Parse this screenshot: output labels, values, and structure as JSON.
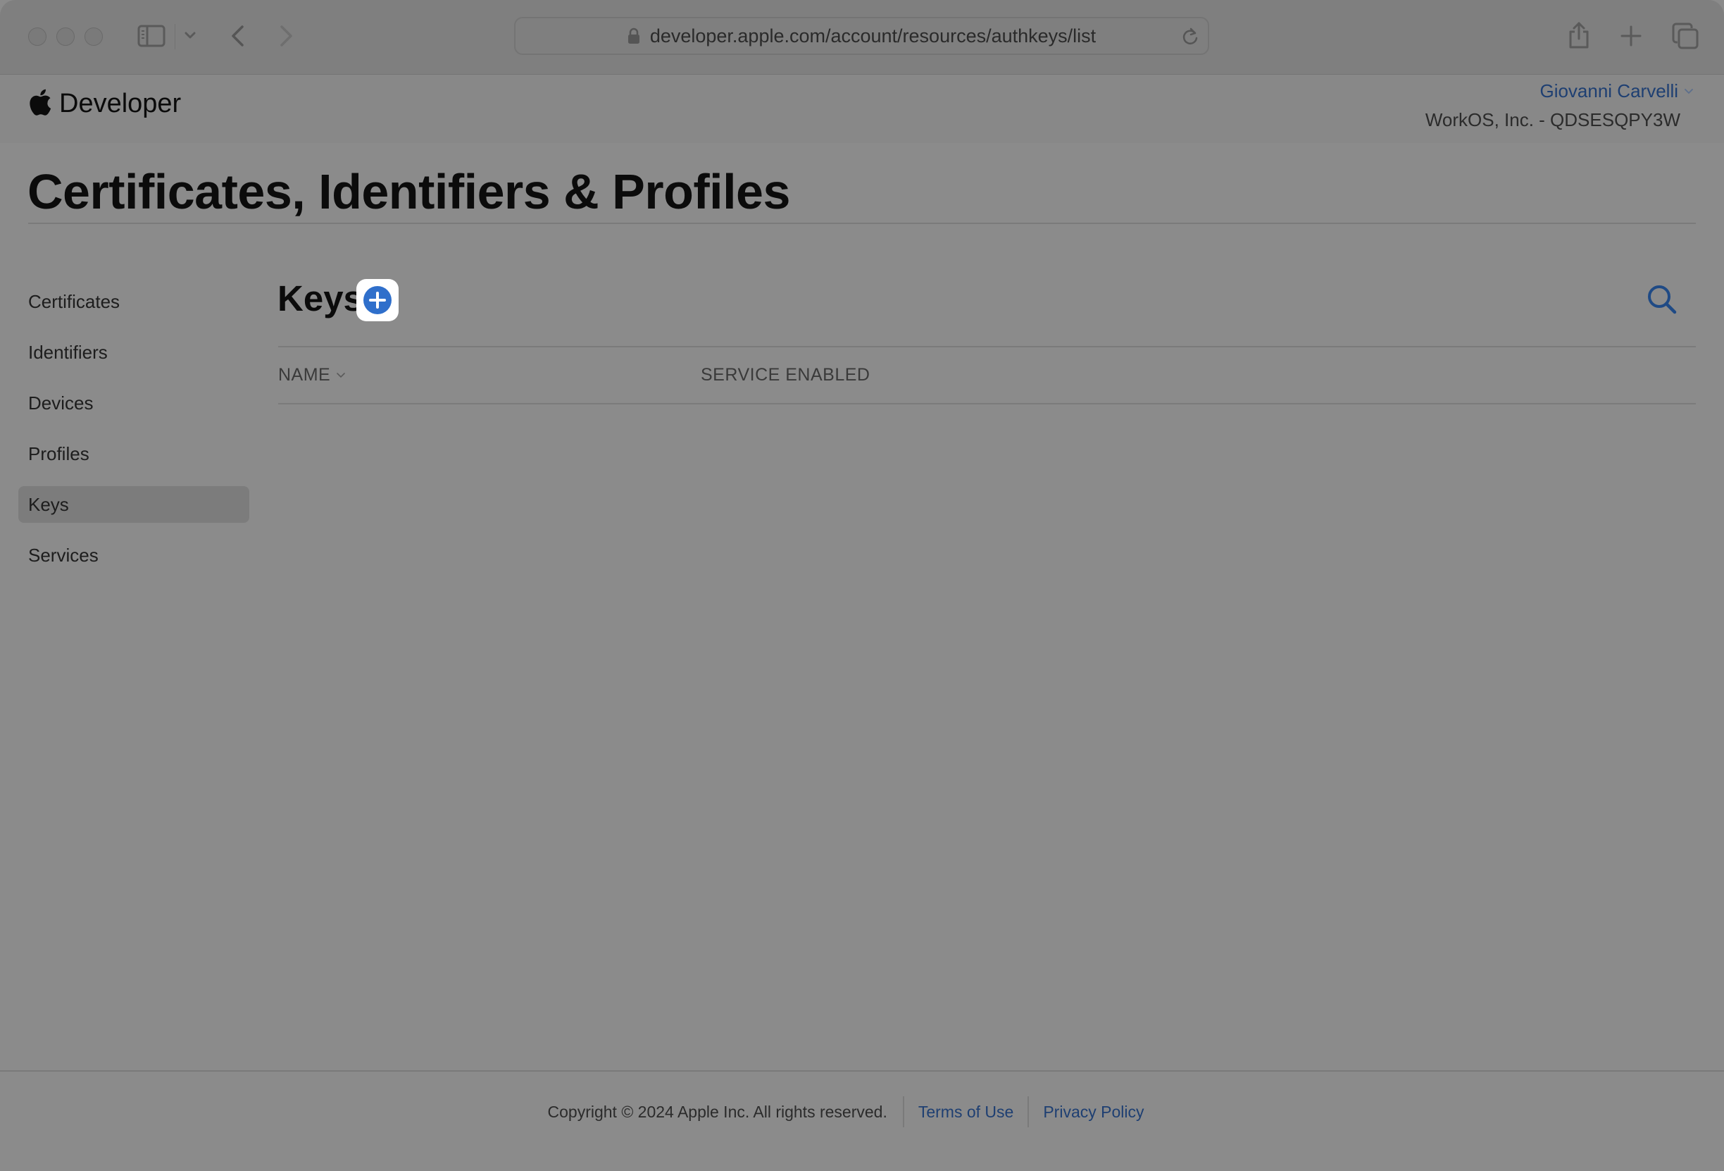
{
  "browser": {
    "url": "developer.apple.com/account/resources/authkeys/list",
    "icons": [
      "close-light",
      "minimize-light",
      "zoom-light",
      "sidebar-icon",
      "chevron-down-icon",
      "back-icon",
      "forward-icon",
      "lock-icon",
      "reload-icon",
      "share-icon",
      "new-tab-icon",
      "tabs-overview-icon"
    ]
  },
  "header": {
    "brand": "Developer",
    "account_name": "Giovanni Carvelli",
    "account_org": "WorkOS, Inc. - QDSESQPY3W"
  },
  "page": {
    "title": "Certificates, Identifiers & Profiles"
  },
  "sidebar": {
    "items": [
      {
        "label": "Certificates",
        "selected": false
      },
      {
        "label": "Identifiers",
        "selected": false
      },
      {
        "label": "Devices",
        "selected": false
      },
      {
        "label": "Profiles",
        "selected": false
      },
      {
        "label": "Keys",
        "selected": true
      },
      {
        "label": "Services",
        "selected": false
      }
    ]
  },
  "main": {
    "heading": "Keys",
    "add_button_icon": "plus-circle-icon",
    "search_icon": "search-icon",
    "table": {
      "columns": [
        {
          "label": "NAME",
          "sortable": true
        },
        {
          "label": "SERVICE ENABLED",
          "sortable": false
        }
      ],
      "rows": []
    }
  },
  "footer": {
    "copyright": "Copyright © 2024 Apple Inc. All rights reserved.",
    "links": [
      "Terms of Use",
      "Privacy Policy"
    ]
  },
  "colors": {
    "link": "#1e3f72",
    "accent": "#2f6fcb",
    "overlay_bg": "#8b8b8b"
  }
}
